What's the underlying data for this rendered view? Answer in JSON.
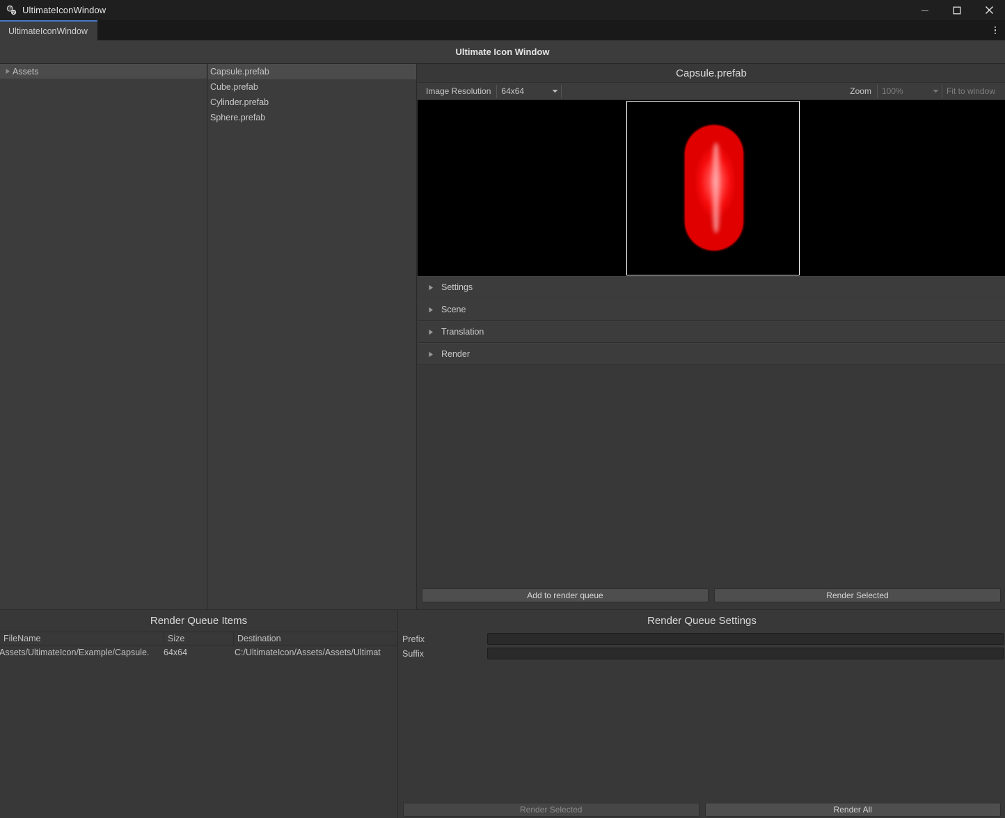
{
  "window": {
    "app_icon": "unity-cube-icon",
    "title": "UltimateIconWindow",
    "minimize_label": "minimize-icon",
    "maximize_label": "maximize-icon",
    "close_label": "close-icon"
  },
  "tabstrip": {
    "tab_label": "UltimateIconWindow",
    "overflow_menu": "kebab-menu-icon"
  },
  "header": {
    "title": "Ultimate Icon Window"
  },
  "tree": {
    "items": [
      {
        "label": "Assets",
        "selected": true,
        "expander": "triangle-right-icon"
      }
    ]
  },
  "asset_list": {
    "items": [
      {
        "label": "Capsule.prefab",
        "selected": true
      },
      {
        "label": "Cube.prefab",
        "selected": false
      },
      {
        "label": "Cylinder.prefab",
        "selected": false
      },
      {
        "label": "Sphere.prefab",
        "selected": false
      }
    ]
  },
  "inspector": {
    "title": "Capsule.prefab",
    "toolbar": {
      "resolution_label": "Image Resolution",
      "resolution_value": "64x64",
      "zoom_label": "Zoom",
      "zoom_value": "100%",
      "fit_label": "Fit to window"
    },
    "preview": {
      "alt": "red-capsule-preview"
    },
    "foldouts": [
      {
        "label": "Settings"
      },
      {
        "label": "Scene"
      },
      {
        "label": "Translation"
      },
      {
        "label": "Render"
      }
    ],
    "buttons": {
      "add_to_queue": "Add to render queue",
      "render_selected": "Render Selected"
    }
  },
  "render_queue_items": {
    "title": "Render Queue Items",
    "columns": [
      "FileName",
      "Size",
      "Destination"
    ],
    "rows": [
      {
        "filename": "Assets/UltimateIcon/Example/Capsule.",
        "size": "64x64",
        "destination": "C:/UltimateIcon/Assets/Assets/Ultimat"
      }
    ]
  },
  "render_queue_settings": {
    "title": "Render Queue Settings",
    "prefix_label": "Prefix",
    "prefix_value": "",
    "suffix_label": "Suffix",
    "suffix_value": "",
    "buttons": {
      "render_selected": "Render Selected",
      "render_all": "Render All"
    }
  },
  "colors": {
    "window_chrome": "#1f1f1f",
    "tab_accent": "#4a78c8",
    "panel": "#3c3c3c",
    "background": "#383838",
    "preview_bg": "#000000",
    "capsule": "#ff2222"
  }
}
